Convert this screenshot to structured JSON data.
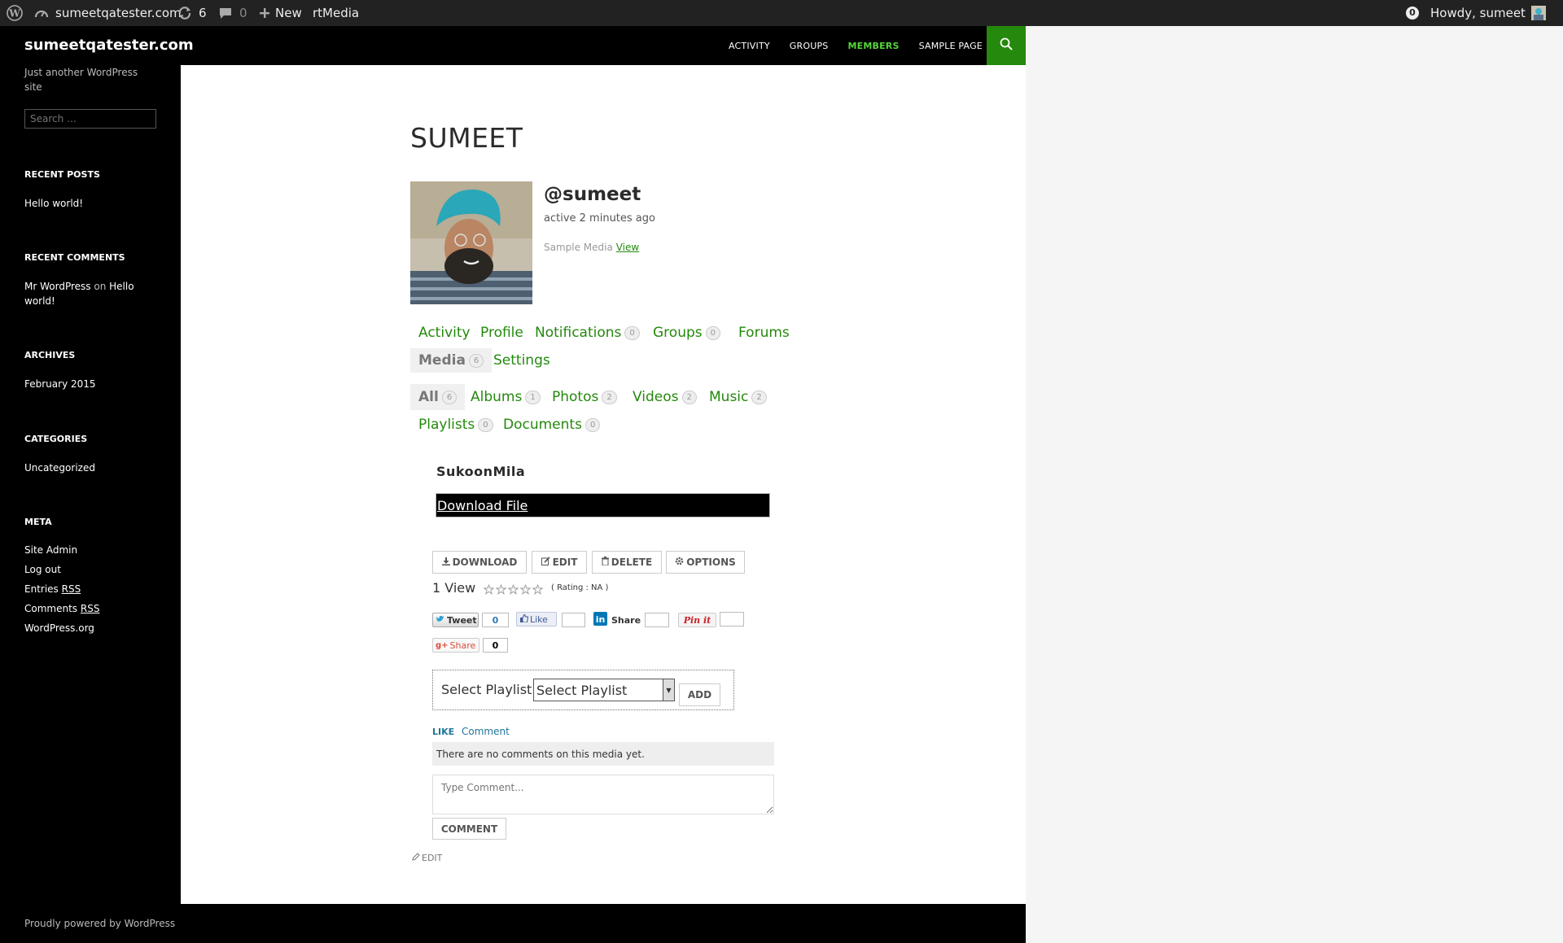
{
  "adminbar": {
    "site_name": "sumeetqatester.com",
    "updates_count": "6",
    "comments_count": "0",
    "new_label": "New",
    "rtmedia_label": "rtMedia",
    "notifications_count": "0",
    "howdy": "Howdy, sumeet"
  },
  "site": {
    "title": "sumeetqatester.com",
    "description": "Just another WordPress site",
    "footer": "Proudly powered by WordPress"
  },
  "nav": {
    "items": [
      "ACTIVITY",
      "GROUPS",
      "MEMBERS",
      "SAMPLE PAGE"
    ],
    "current": "MEMBERS"
  },
  "sidebar": {
    "search_placeholder": "Search …",
    "recent_posts_title": "RECENT POSTS",
    "recent_posts": [
      "Hello world!"
    ],
    "recent_comments_title": "RECENT COMMENTS",
    "recent_comment_author": "Mr WordPress",
    "recent_comment_on": "on",
    "recent_comment_post_line1": "Hello",
    "recent_comment_post_line2": "world!",
    "archives_title": "ARCHIVES",
    "archives": [
      "February 2015"
    ],
    "categories_title": "CATEGORIES",
    "categories": [
      "Uncategorized"
    ],
    "meta_title": "META",
    "meta_site_admin": "Site Admin",
    "meta_logout": "Log out",
    "meta_entries": "Entries",
    "meta_comments": "Comments",
    "meta_rss": "RSS",
    "meta_wordpress": "WordPress.org"
  },
  "profile": {
    "page_title": "SUMEET",
    "handle": "@sumeet",
    "active": "active 2 minutes ago",
    "sample_media_label": "Sample Media",
    "sample_media_link": "View"
  },
  "profile_tabs": {
    "activity": "Activity",
    "profile": "Profile",
    "notifications": "Notifications",
    "notifications_count": "0",
    "groups": "Groups",
    "groups_count": "0",
    "forums": "Forums",
    "media": "Media",
    "media_count": "6",
    "settings": "Settings"
  },
  "media_tabs": {
    "all": "All",
    "all_count": "6",
    "albums": "Albums",
    "albums_count": "1",
    "photos": "Photos",
    "photos_count": "2",
    "videos": "Videos",
    "videos_count": "2",
    "music": "Music",
    "music_count": "2",
    "playlists": "Playlists",
    "playlists_count": "0",
    "documents": "Documents",
    "documents_count": "0"
  },
  "media": {
    "title": "SukoonMila",
    "download_file": "Download File",
    "actions": {
      "download": "DOWNLOAD",
      "edit": "EDIT",
      "delete": "DELETE",
      "options": "OPTIONS"
    },
    "views": "1 View",
    "rating": "( Rating : NA )"
  },
  "social": {
    "tweet": "Tweet",
    "tweet_count": "0",
    "like": "Like",
    "share": "Share",
    "pinit": "Pin it",
    "gplus_share": "Share",
    "gplus_count": "0"
  },
  "playlist": {
    "label": "Select Playlist:",
    "selected": "Select Playlist",
    "add": "ADD"
  },
  "comments": {
    "like": "LIKE",
    "comment_link": "Comment",
    "none": "There are no comments on this media yet.",
    "placeholder": "Type Comment...",
    "submit": "COMMENT"
  },
  "edit_link": "EDIT",
  "colors": {
    "accent_green": "#24890d",
    "nav_current": "#55d737",
    "link_blue": "#21759b"
  }
}
